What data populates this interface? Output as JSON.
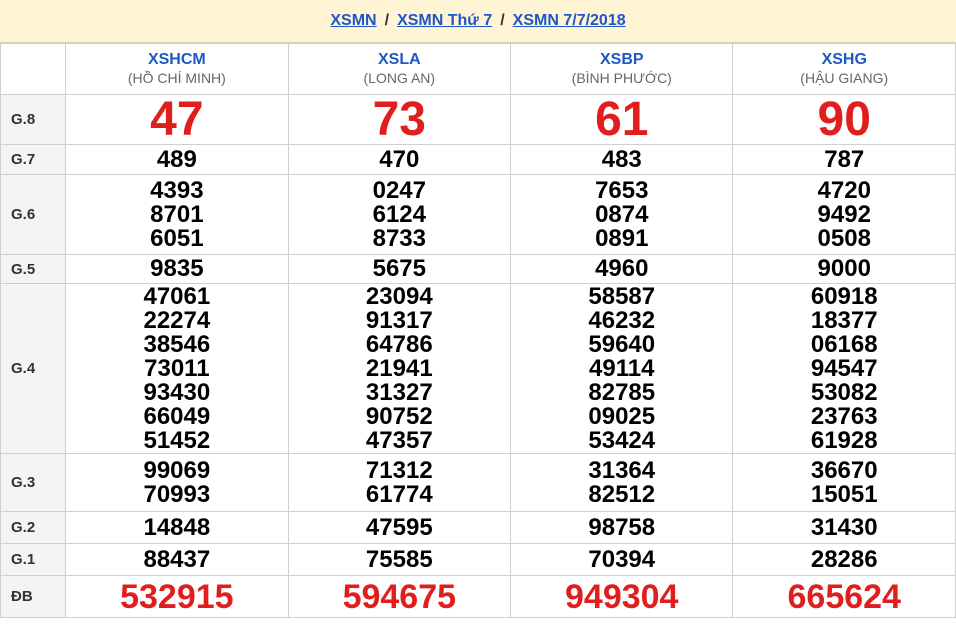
{
  "breadcrumb": {
    "links": [
      "XSMN",
      "XSMN Thứ 7",
      "XSMN 7/7/2018"
    ],
    "separator": "/"
  },
  "provinces": [
    {
      "code": "XSHCM",
      "name": "(HỒ CHÍ MINH)"
    },
    {
      "code": "XSLA",
      "name": "(LONG AN)"
    },
    {
      "code": "XSBP",
      "name": "(BÌNH PHƯỚC)"
    },
    {
      "code": "XSHG",
      "name": "(HẬU GIANG)"
    }
  ],
  "prizes": [
    {
      "label": "G.8",
      "style": "big",
      "values": [
        [
          "47"
        ],
        [
          "73"
        ],
        [
          "61"
        ],
        [
          "90"
        ]
      ]
    },
    {
      "label": "G.7",
      "style": "num",
      "values": [
        [
          "489"
        ],
        [
          "470"
        ],
        [
          "483"
        ],
        [
          "787"
        ]
      ]
    },
    {
      "label": "G.6",
      "style": "num",
      "values": [
        [
          "4393",
          "8701",
          "6051"
        ],
        [
          "0247",
          "6124",
          "8733"
        ],
        [
          "7653",
          "0874",
          "0891"
        ],
        [
          "4720",
          "9492",
          "0508"
        ]
      ]
    },
    {
      "label": "G.5",
      "style": "num",
      "values": [
        [
          "9835"
        ],
        [
          "5675"
        ],
        [
          "4960"
        ],
        [
          "9000"
        ]
      ]
    },
    {
      "label": "G.4",
      "style": "num",
      "values": [
        [
          "47061",
          "22274",
          "38546",
          "73011",
          "93430",
          "66049",
          "51452"
        ],
        [
          "23094",
          "91317",
          "64786",
          "21941",
          "31327",
          "90752",
          "47357"
        ],
        [
          "58587",
          "46232",
          "59640",
          "49114",
          "82785",
          "09025",
          "53424"
        ],
        [
          "60918",
          "18377",
          "06168",
          "94547",
          "53082",
          "23763",
          "61928"
        ]
      ]
    },
    {
      "label": "G.3",
      "style": "num",
      "values": [
        [
          "99069",
          "70993"
        ],
        [
          "71312",
          "61774"
        ],
        [
          "31364",
          "82512"
        ],
        [
          "36670",
          "15051"
        ]
      ]
    },
    {
      "label": "G.2",
      "style": "num",
      "values": [
        [
          "14848"
        ],
        [
          "47595"
        ],
        [
          "98758"
        ],
        [
          "31430"
        ]
      ]
    },
    {
      "label": "G.1",
      "style": "num",
      "values": [
        [
          "88437"
        ],
        [
          "75585"
        ],
        [
          "70394"
        ],
        [
          "28286"
        ]
      ]
    },
    {
      "label": "ĐB",
      "style": "db",
      "values": [
        [
          "532915"
        ],
        [
          "594675"
        ],
        [
          "949304"
        ],
        [
          "665624"
        ]
      ]
    }
  ]
}
